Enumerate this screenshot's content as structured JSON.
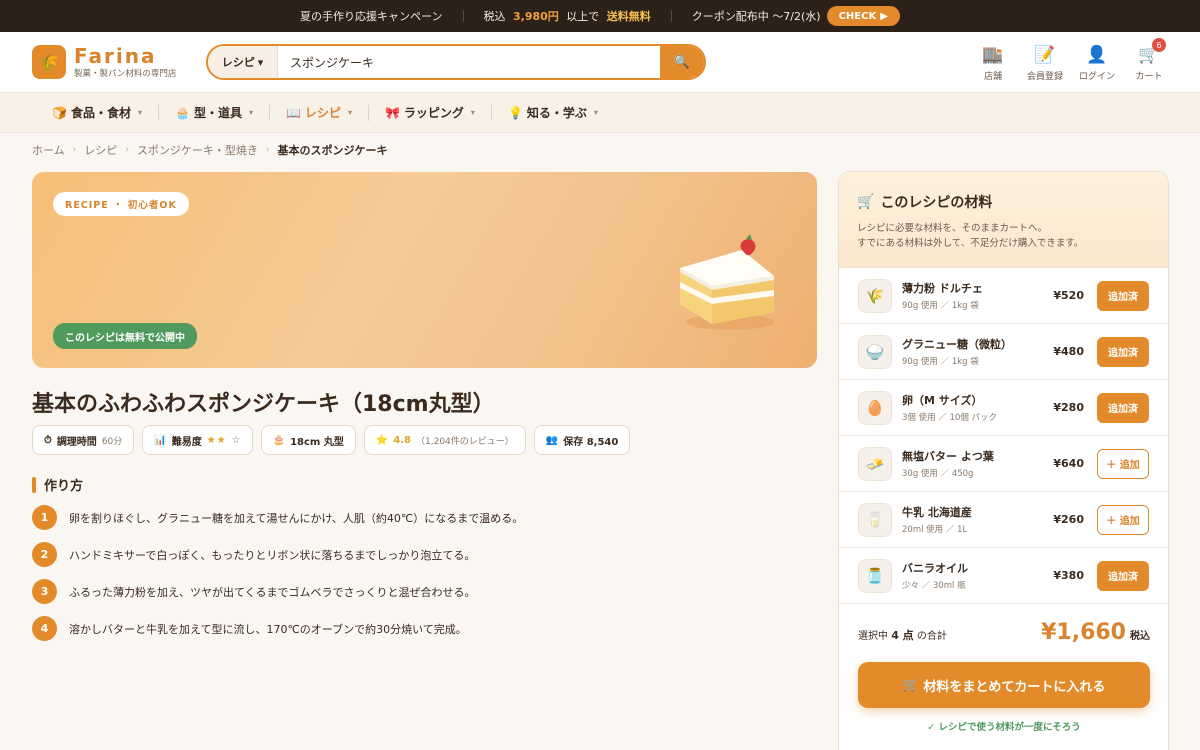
{
  "announce": {
    "campaign": "夏の手作り応援キャンペーン",
    "shipping_prefix": "税込",
    "shipping_amount": "3,980円",
    "shipping_mid": "以上で",
    "shipping_free": "送料無料",
    "coupon": "クーポン配布中 〜7/2(水)",
    "check_label": "CHECK",
    "check_icon": "▶"
  },
  "header": {
    "logo_name": "Farina",
    "logo_sub": "製菓・製パン材料の専門店",
    "search_category": "レシピ",
    "search_value": "スポンジケーキ",
    "icons": [
      {
        "label": "店舗",
        "icon": "building-icon",
        "glyph": "🏬"
      },
      {
        "label": "会員登録",
        "icon": "memo-icon",
        "glyph": "📝"
      },
      {
        "label": "ログイン",
        "icon": "user-icon",
        "glyph": "👤"
      },
      {
        "label": "カート",
        "icon": "cart-icon",
        "glyph": "🛒",
        "badge": "6"
      }
    ]
  },
  "catnav": [
    {
      "label": "食品・食材",
      "glyph": "🍞",
      "active": false
    },
    {
      "label": "型・道具",
      "glyph": "🧁",
      "active": false
    },
    {
      "label": "レシピ",
      "glyph": "📖",
      "active": true
    },
    {
      "label": "ラッピング",
      "glyph": "🎀",
      "active": false
    },
    {
      "label": "知る・学ぶ",
      "glyph": "💡",
      "active": false
    }
  ],
  "breadcrumb": [
    "ホーム",
    "レシピ",
    "スポンジケーキ・型焼き",
    "基本のスポンジケーキ"
  ],
  "hero": {
    "tag": "RECIPE ・ 初心者OK",
    "free_label": "このレシピは無料で公開中"
  },
  "recipe": {
    "title": "基本のふわふわスポンジケーキ（18cm丸型）",
    "cook_time_label": "調理時間",
    "cook_time_value": "60分",
    "difficulty_label": "難易度",
    "difficulty_stars": "★★",
    "difficulty_empty": "☆",
    "size": "18cm 丸型",
    "rating": "4.8",
    "reviews": "（1,204件のレビュー）",
    "saves": "保存 8,540"
  },
  "steps": {
    "heading": "作り方",
    "items": [
      "卵を割りほぐし、グラニュー糖を加えて湯せんにかけ、人肌（約40℃）になるまで温める。",
      "ハンドミキサーで白っぽく、もったりとリボン状に落ちるまでしっかり泡立てる。",
      "ふるった薄力粉を加え、ツヤが出てくるまでゴムベラでさっくりと混ぜ合わせる。",
      "溶かしバターと牛乳を加えて型に流し、170℃のオーブンで約30分焼いて完成。"
    ]
  },
  "panel": {
    "title": "このレシピの材料",
    "desc_line1": "レシピに必要な材料を、そのままカートへ。",
    "desc_line2": "すでにある材料は外して、不足分だけ購入できます。",
    "ingredients": [
      {
        "name": "薄力粉 ドルチェ",
        "amount": "90g 使用 ／ 1kg 袋",
        "price": "¥520",
        "button": "追加済",
        "added": true,
        "glyph": "🌾",
        "icon": "wheat-icon"
      },
      {
        "name": "グラニュー糖（微粒）",
        "amount": "90g 使用 ／ 1kg 袋",
        "price": "¥480",
        "button": "追加済",
        "added": true,
        "glyph": "🍚",
        "icon": "sugar-icon"
      },
      {
        "name": "卵（M サイズ）",
        "amount": "3個 使用 ／ 10個 パック",
        "price": "¥280",
        "button": "追加済",
        "added": true,
        "glyph": "🥚",
        "icon": "egg-icon"
      },
      {
        "name": "無塩バター よつ葉",
        "amount": "30g 使用 ／ 450g",
        "price": "¥640",
        "button": "＋ 追加",
        "added": false,
        "glyph": "🧈",
        "icon": "butter-icon"
      },
      {
        "name": "牛乳 北海道産",
        "amount": "20ml 使用 ／ 1L",
        "price": "¥260",
        "button": "＋ 追加",
        "added": false,
        "glyph": "🥛",
        "icon": "milk-icon"
      },
      {
        "name": "バニラオイル",
        "amount": "少々 ／ 30ml 瓶",
        "price": "¥380",
        "button": "追加済",
        "added": true,
        "glyph": "🫙",
        "icon": "jar-icon"
      }
    ],
    "total_prefix": "選択中",
    "total_count": "4 点",
    "total_suffix": "の合計",
    "total_price": "¥1,660",
    "tax_label": "税込",
    "cart_button": "材料をまとめてカートに入れる",
    "cart_note": "✓ レシピで使う材料が一度にそろう"
  },
  "colors": {
    "accent": "#e38a2b",
    "green": "#4f9a5c",
    "dark_bar": "#2b2118"
  }
}
